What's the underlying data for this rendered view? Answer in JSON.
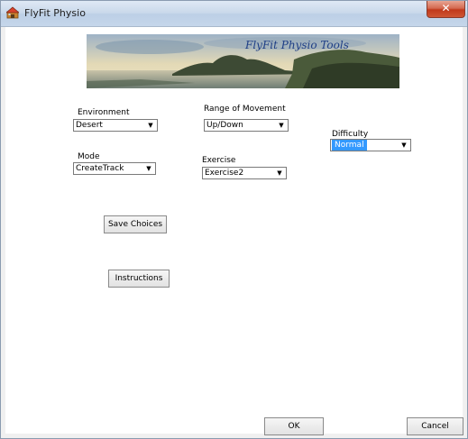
{
  "window": {
    "title": "FlyFit Physio",
    "close_label": "✕"
  },
  "banner": {
    "title": "FlyFit Physio Tools"
  },
  "fields": {
    "environment": {
      "label": "Environment",
      "value": "Desert"
    },
    "range_of_movement": {
      "label": "Range of Movement",
      "value": "Up/Down"
    },
    "difficulty": {
      "label": "Difficulty",
      "value": "Normal"
    },
    "mode": {
      "label": "Mode",
      "value": "CreateTrack"
    },
    "exercise": {
      "label": "Exercise",
      "value": "Exercise2"
    }
  },
  "buttons": {
    "save_choices": "Save Choices",
    "instructions": "Instructions",
    "ok": "OK",
    "cancel": "Cancel"
  },
  "icons": {
    "dropdown_arrow": "▼"
  }
}
